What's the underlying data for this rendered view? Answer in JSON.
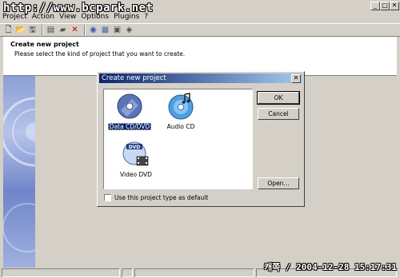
{
  "watermark_text": "http://www.bcpark.net",
  "window_controls": {
    "minimize": "_",
    "maximize": "□",
    "close": "✕"
  },
  "menubar": [
    {
      "label": "Project"
    },
    {
      "label": "Action"
    },
    {
      "label": "View"
    },
    {
      "label": "Options"
    },
    {
      "label": "Plugins"
    },
    {
      "label": "?"
    }
  ],
  "toolbar": [
    {
      "icon": "new-icon",
      "glyph": "🗋"
    },
    {
      "icon": "open-icon",
      "glyph": "📂"
    },
    {
      "icon": "save-icon",
      "glyph": "🖫"
    },
    {
      "icon": "print-icon",
      "glyph": "▤"
    },
    {
      "icon": "folder-icon",
      "glyph": "▰"
    },
    {
      "icon": "delete-icon",
      "glyph": "✕",
      "color": "#c00000"
    },
    {
      "icon": "burn-icon",
      "glyph": "◉"
    },
    {
      "icon": "properties-icon",
      "glyph": "▦"
    },
    {
      "icon": "drive-icon",
      "glyph": "▣"
    },
    {
      "icon": "recorder-icon",
      "glyph": "◈"
    }
  ],
  "header": {
    "title": "Create new project",
    "subtitle": "Please select the kind of project that you want to create."
  },
  "dialog": {
    "title": "Create new project",
    "close_glyph": "✕",
    "project_types": [
      {
        "label": "Data CD/DVD",
        "icon": "data-cd-icon",
        "selected": true
      },
      {
        "label": "Audio CD",
        "icon": "audio-cd-icon",
        "selected": false
      },
      {
        "label": "Video DVD",
        "icon": "video-dvd-icon",
        "selected": false
      }
    ],
    "buttons": {
      "ok": "OK",
      "cancel": "Cancel",
      "open": "Open..."
    },
    "default_checkbox_label": "Use this project type as default",
    "default_checked": false
  },
  "timestamp_stamp": "캐쪽 / 2004-12-28 15:17:31",
  "colors": {
    "selection": "#0a246a",
    "titlebar_start": "#0a246a",
    "titlebar_end": "#a6caf0",
    "face": "#d4d0c8"
  }
}
